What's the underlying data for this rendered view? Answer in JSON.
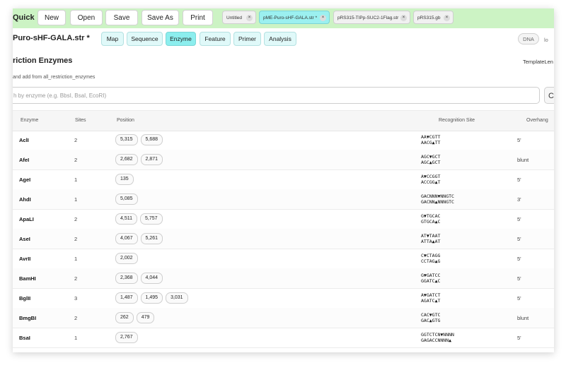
{
  "app": {
    "name": "Quick"
  },
  "toolbar": {
    "new_label": "New",
    "open_label": "Open",
    "save_label": "Save",
    "save_as_label": "Save As",
    "print_label": "Print"
  },
  "doc_tabs": [
    {
      "label": "Untitled",
      "close": "×"
    },
    {
      "label": "pME-Puro-sHF-GALA.str *",
      "close": "×"
    },
    {
      "label": "pRS315-TIPp-SUC2-1Flag.str",
      "close": "×"
    },
    {
      "label": "pRS315.gb",
      "close": "×"
    }
  ],
  "document": {
    "title": "Puro-sHF-GALA.str *"
  },
  "view_tabs": [
    "Map",
    "Sequence",
    "Enzyme",
    "Feature",
    "Primer",
    "Analysis"
  ],
  "view_toggle": {
    "dna_label": "DNA",
    "cut_text": "lo"
  },
  "panel": {
    "title": "riction Enzymes",
    "template_label": "TemplateLen",
    "subtext": "and add from all_restriction_enzymes"
  },
  "search": {
    "placeholder": "h by enzyme (e.g. BbsI, BsaI, EcoRI)",
    "button_label": "C"
  },
  "table": {
    "headers": {
      "enzyme": "Enzyme",
      "sites": "Sites",
      "position": "Position",
      "recognition": "Recognition Site",
      "overhang": "Overhang"
    },
    "rows": [
      {
        "name": "AclI",
        "sites": "2",
        "positions": [
          "5,315",
          "5,688"
        ],
        "site_top": "AA▼CGTT",
        "site_bottom": "AACG▲TT",
        "overhang": "5'"
      },
      {
        "name": "AfeI",
        "sites": "2",
        "positions": [
          "2,682",
          "2,871"
        ],
        "site_top": "AGC▼GCT",
        "site_bottom": "AGC▲GCT",
        "overhang": "blunt"
      },
      {
        "name": "AgeI",
        "sites": "1",
        "positions": [
          "135"
        ],
        "site_top": "A▼CCGGT",
        "site_bottom": "ACCGG▲T",
        "overhang": "5'"
      },
      {
        "name": "AhdI",
        "sites": "1",
        "positions": [
          "5,085"
        ],
        "site_top": "GACNNN▼NNGTC",
        "site_bottom": "GACNN▲NNNGTC",
        "overhang": "3'"
      },
      {
        "name": "ApaLI",
        "sites": "2",
        "positions": [
          "4,511",
          "5,757"
        ],
        "site_top": "G▼TGCAC",
        "site_bottom": "GTGCA▲C",
        "overhang": "5'"
      },
      {
        "name": "AseI",
        "sites": "2",
        "positions": [
          "4,067",
          "5,261"
        ],
        "site_top": "AT▼TAAT",
        "site_bottom": "ATTA▲AT",
        "overhang": "5'"
      },
      {
        "name": "AvrII",
        "sites": "1",
        "positions": [
          "2,002"
        ],
        "site_top": "C▼CTAGG",
        "site_bottom": "CCTAG▲G",
        "overhang": "5'"
      },
      {
        "name": "BamHI",
        "sites": "2",
        "positions": [
          "2,368",
          "4,044"
        ],
        "site_top": "G▼GATCC",
        "site_bottom": "GGATC▲C",
        "overhang": "5'"
      },
      {
        "name": "BglII",
        "sites": "3",
        "positions": [
          "1,487",
          "1,495",
          "3,031"
        ],
        "site_top": "A▼GATCT",
        "site_bottom": "AGATC▲T",
        "overhang": "5'"
      },
      {
        "name": "BmgBI",
        "sites": "2",
        "positions": [
          "262",
          "479"
        ],
        "site_top": "CAC▼GTC",
        "site_bottom": "GAC▲GTG",
        "overhang": "blunt"
      },
      {
        "name": "BsaI",
        "sites": "1",
        "positions": [
          "2,767"
        ],
        "site_top": "GGTCTCN▼NNNN",
        "site_bottom": "GAGACCNNNN▲",
        "overhang": "5'"
      }
    ]
  },
  "colors": {
    "topbar_bg": "#ccf3c4",
    "active_tab": "#9bf0f0",
    "view_tab": "#e0f9f9",
    "view_tab_active": "#8ceeee"
  }
}
